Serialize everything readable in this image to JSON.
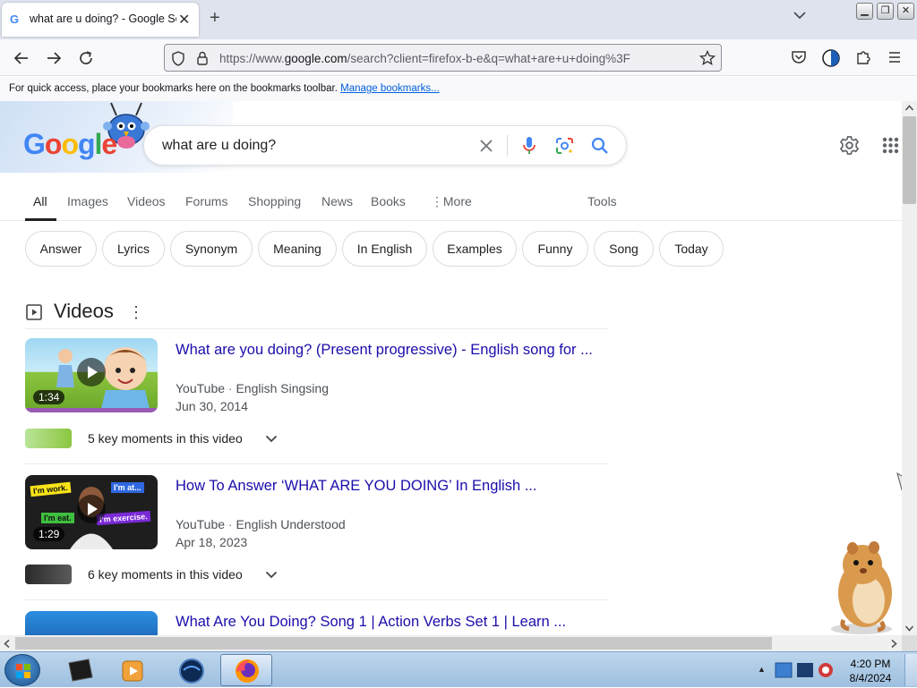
{
  "browser": {
    "tab_title": "what are u doing? - Google Sea",
    "tab_favicon": "G",
    "url_prefix": "https://www.",
    "url_domain": "google.com",
    "url_path": "/search?client=firefox-b-e&q=what+are+u+doing%3F",
    "bookmarks_hint": "For quick access, place your bookmarks here on the bookmarks toolbar.",
    "manage_bookmarks": "Manage bookmarks..."
  },
  "google": {
    "logo_letters": [
      "G",
      "o",
      "o",
      "g",
      "l",
      "e"
    ],
    "query": "what are u doing?",
    "tabs": [
      "All",
      "Images",
      "Videos",
      "Forums",
      "Shopping",
      "News",
      "Books",
      "More",
      "Tools"
    ],
    "chips": [
      "Answer",
      "Lyrics",
      "Synonym",
      "Meaning",
      "In English",
      "Examples",
      "Funny",
      "Song",
      "Today"
    ],
    "videos_heading": "Videos",
    "videos": [
      {
        "title": "What are you doing? (Present progressive) - English song for ...",
        "source": "YouTube",
        "channel": "English Singsing",
        "date": "Jun 30, 2014",
        "duration": "1:34",
        "key_moments": "5 key moments in this video"
      },
      {
        "title": "How To Answer ‘WHAT ARE YOU DOING’ In English ...",
        "source": "YouTube",
        "channel": "English Understood",
        "date": "Apr 18, 2023",
        "duration": "1:29",
        "key_moments": "6 key moments in this video"
      },
      {
        "title": "What Are You Doing? Song 1 | Action Verbs Set 1 | Learn ..."
      }
    ],
    "thumb2_labels": [
      "I'm work.",
      "I'm at...",
      "I'm eat.",
      "I'm exercise."
    ],
    "separator": "·"
  },
  "taskbar": {
    "time": "4:20 PM",
    "date": "8/4/2024"
  },
  "colors": {
    "link": "#1a0dab",
    "google_blue": "#4285f4",
    "google_red": "#ea4335",
    "google_yellow": "#fbbc05",
    "google_green": "#34a853"
  }
}
